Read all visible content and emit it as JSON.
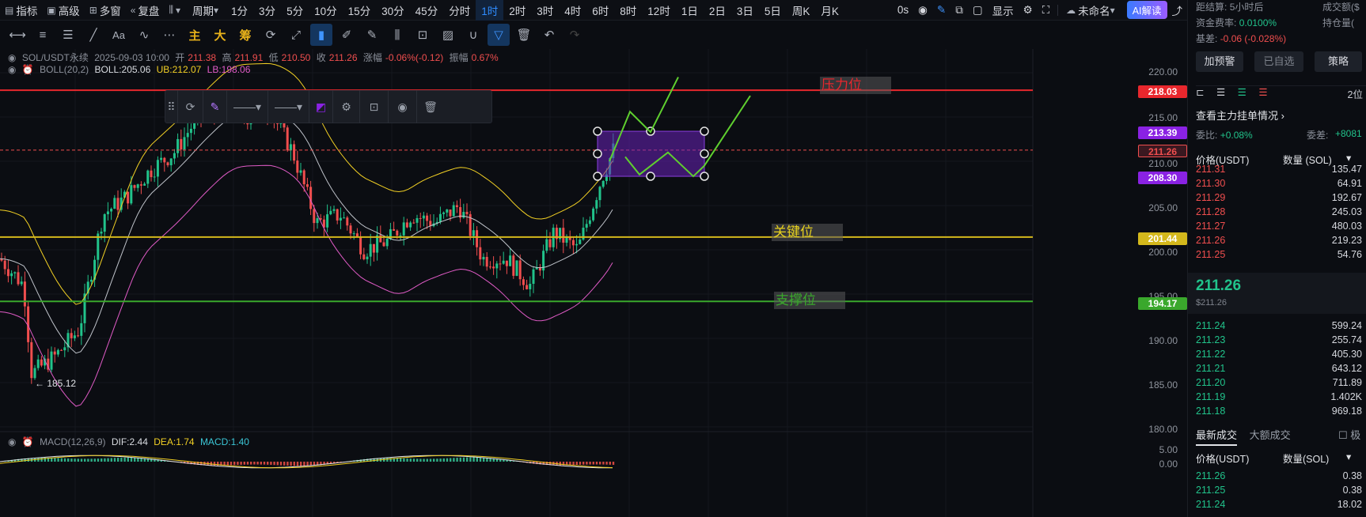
{
  "topbar": {
    "indicator": "指标",
    "advanced": "高级",
    "multiwindow": "多窗",
    "replay": "复盘",
    "period": "周期",
    "timeframes": [
      "1分",
      "3分",
      "5分",
      "10分",
      "15分",
      "30分",
      "45分",
      "分时",
      "1时",
      "2时",
      "3时",
      "4时",
      "6时",
      "8时",
      "12时",
      "1日",
      "2日",
      "3日",
      "5日",
      "周K",
      "月K"
    ],
    "active_timeframe": "1时",
    "countdown": "0s",
    "display": "显示",
    "unnamed": "未命名",
    "ai_button": "AI解读"
  },
  "drawbar": {
    "main": "主",
    "big": "大",
    "chips": "筹"
  },
  "legend": {
    "symbol": "SOL/USDT永续",
    "datetime": "2025-09-03 10:00",
    "open_label": "开",
    "open": "211.38",
    "high_label": "高",
    "high": "211.91",
    "low_label": "低",
    "low": "210.50",
    "close_label": "收",
    "close": "211.26",
    "change_label": "涨幅",
    "change": "-0.06%(-0.12)",
    "amp_label": "振幅",
    "amp": "0.67%",
    "boll_name": "BOLL(20,2)",
    "boll_val": "BOLL:205.06",
    "boll_ub": "UB:212.07",
    "boll_lb": "LB:198.06",
    "macd_name": "MACD(12,26,9)",
    "macd_dif": "DIF:2.44",
    "macd_dea": "DEA:1.74",
    "macd_val": "MACD:1.40"
  },
  "axis": {
    "ticks": [
      "220.00",
      "215.00",
      "210.00",
      "205.00",
      "200.00",
      "195.00",
      "190.00",
      "185.00",
      "180.00"
    ],
    "macd_ticks": [
      "5.00",
      "0.00"
    ]
  },
  "price_labels": {
    "resistance": "218.03",
    "box_top": "213.39",
    "current": "211.26",
    "box_bottom": "208.30",
    "key": "201.44",
    "support": "194.17"
  },
  "line_tags": {
    "resistance": "压力位",
    "key": "关键位",
    "support": "支撑位"
  },
  "low_marker": "← 185.12",
  "colors": {
    "resistance": "#e8272d",
    "key": "#d4b81c",
    "support": "#3aa82c",
    "box": "#6a23b8",
    "up": "#21c38b",
    "down": "#f04e4e"
  },
  "right_panel": {
    "settle_label": "距结算:",
    "settle_value": "5小时后",
    "volume_label": "成交额($",
    "funding_label": "资金费率:",
    "funding_value": "0.0100%",
    "oi_label": "持仓量(",
    "basis_label": "基差:",
    "basis_value": "-0.06 (-0.028%)",
    "btn_alert": "加预警",
    "btn_watch": "已自选",
    "btn_strategy": "策略",
    "depth_digits": "2位",
    "orderbook_link": "查看主力挂单情况",
    "ratio_label": "委比:",
    "ratio_value": "+0.08%",
    "diff_label": "委差:",
    "diff_value": "+8081",
    "col_price": "价格(USDT)",
    "col_qty": "数量 (SOL)",
    "asks": [
      {
        "p": "211.31",
        "q": "135.47"
      },
      {
        "p": "211.30",
        "q": "64.91"
      },
      {
        "p": "211.29",
        "q": "192.67"
      },
      {
        "p": "211.28",
        "q": "245.03"
      },
      {
        "p": "211.27",
        "q": "480.03"
      },
      {
        "p": "211.26",
        "q": "219.23"
      },
      {
        "p": "211.25",
        "q": "54.76"
      }
    ],
    "last_price": "211.26",
    "last_price_usd": "$211.26",
    "bids": [
      {
        "p": "211.24",
        "q": "599.24"
      },
      {
        "p": "211.23",
        "q": "255.74"
      },
      {
        "p": "211.22",
        "q": "405.30"
      },
      {
        "p": "211.21",
        "q": "643.12"
      },
      {
        "p": "211.20",
        "q": "711.89"
      },
      {
        "p": "211.19",
        "q": "1.402K"
      },
      {
        "p": "211.18",
        "q": "969.18"
      }
    ],
    "tab_trades": "最新成交",
    "tab_big": "大额成交",
    "extreme": "极",
    "trades_col_price": "价格(USDT)",
    "trades_col_qty": "数量(SOL)",
    "trades": [
      {
        "p": "211.26",
        "q": "0.38"
      },
      {
        "p": "211.25",
        "q": "0.38"
      },
      {
        "p": "211.24",
        "q": "18.02"
      }
    ]
  }
}
